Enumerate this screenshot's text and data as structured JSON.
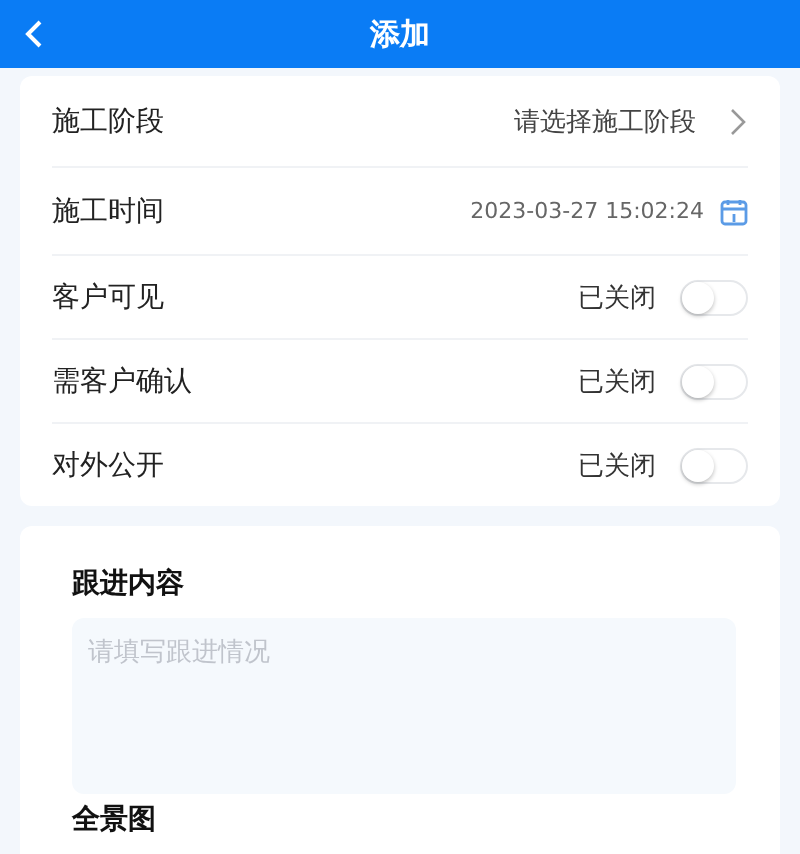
{
  "header": {
    "title": "添加"
  },
  "form_rows": [
    {
      "kind": "select",
      "label": "施工阶段",
      "placeholder": "请选择施工阶段"
    },
    {
      "kind": "datetime",
      "label": "施工时间",
      "value": "2023-03-27 15:02:24"
    },
    {
      "kind": "toggle",
      "label": "客户可见",
      "status": "已关闭",
      "on": false
    },
    {
      "kind": "toggle",
      "label": "需客户确认",
      "status": "已关闭",
      "on": false
    },
    {
      "kind": "toggle",
      "label": "对外公开",
      "status": "已关闭",
      "on": false
    }
  ],
  "follow_up": {
    "title": "跟进内容",
    "placeholder": "请填写跟进情况"
  },
  "next_section": {
    "title": "全景图"
  }
}
